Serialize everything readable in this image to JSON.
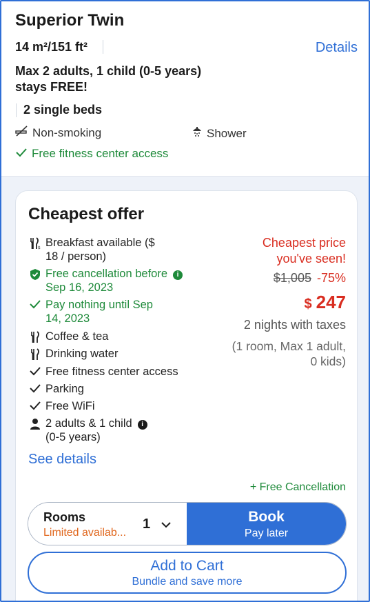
{
  "room": {
    "title": "Superior Twin",
    "size": "14 m²/151 ft²",
    "details_label": "Details",
    "occupancy_line1": "Max 2 adults, 1 child (0-5 years)",
    "occupancy_line2": "stays FREE!",
    "beds": "2 single beds",
    "features": {
      "smoking": "Non-smoking",
      "shower": "Shower",
      "fitness": "Free fitness center access"
    }
  },
  "offer": {
    "title": "Cheapest offer",
    "amenities": {
      "breakfast_1": "Breakfast available ($",
      "breakfast_2": "18 / person)",
      "cancellation_1": "Free cancellation before",
      "cancellation_2": "Sep 16, 2023",
      "pay_1": "Pay nothing until Sep",
      "pay_2": "14, 2023",
      "coffee": "Coffee & tea",
      "water": "Drinking water",
      "fitness": "Free fitness center access",
      "parking": "Parking",
      "wifi": "Free WiFi",
      "guests_1": "2 adults & 1 child",
      "guests_2": "(0-5 years)"
    },
    "price": {
      "note_1": "Cheapest price",
      "note_2": "you've seen!",
      "original": "$1,005",
      "discount": "-75%",
      "currency": "$",
      "amount": "247",
      "nights": "2 nights with taxes",
      "rooms_1": "(1 room, Max 1 adult,",
      "rooms_2": "0 kids)"
    },
    "see_details": "See details",
    "free_cancellation": "+ Free Cancellation",
    "rooms_selector": {
      "label": "Rooms",
      "availability": "Limited availab...",
      "quantity": "1"
    },
    "book": {
      "label": "Book",
      "sub": "Pay later"
    },
    "cart": {
      "label": "Add to Cart",
      "sub": "Bundle and save more"
    }
  },
  "colors": {
    "accent": "#2f6fd6",
    "green": "#1e8a3a",
    "red": "#d92d20",
    "orange": "#e0651b"
  }
}
